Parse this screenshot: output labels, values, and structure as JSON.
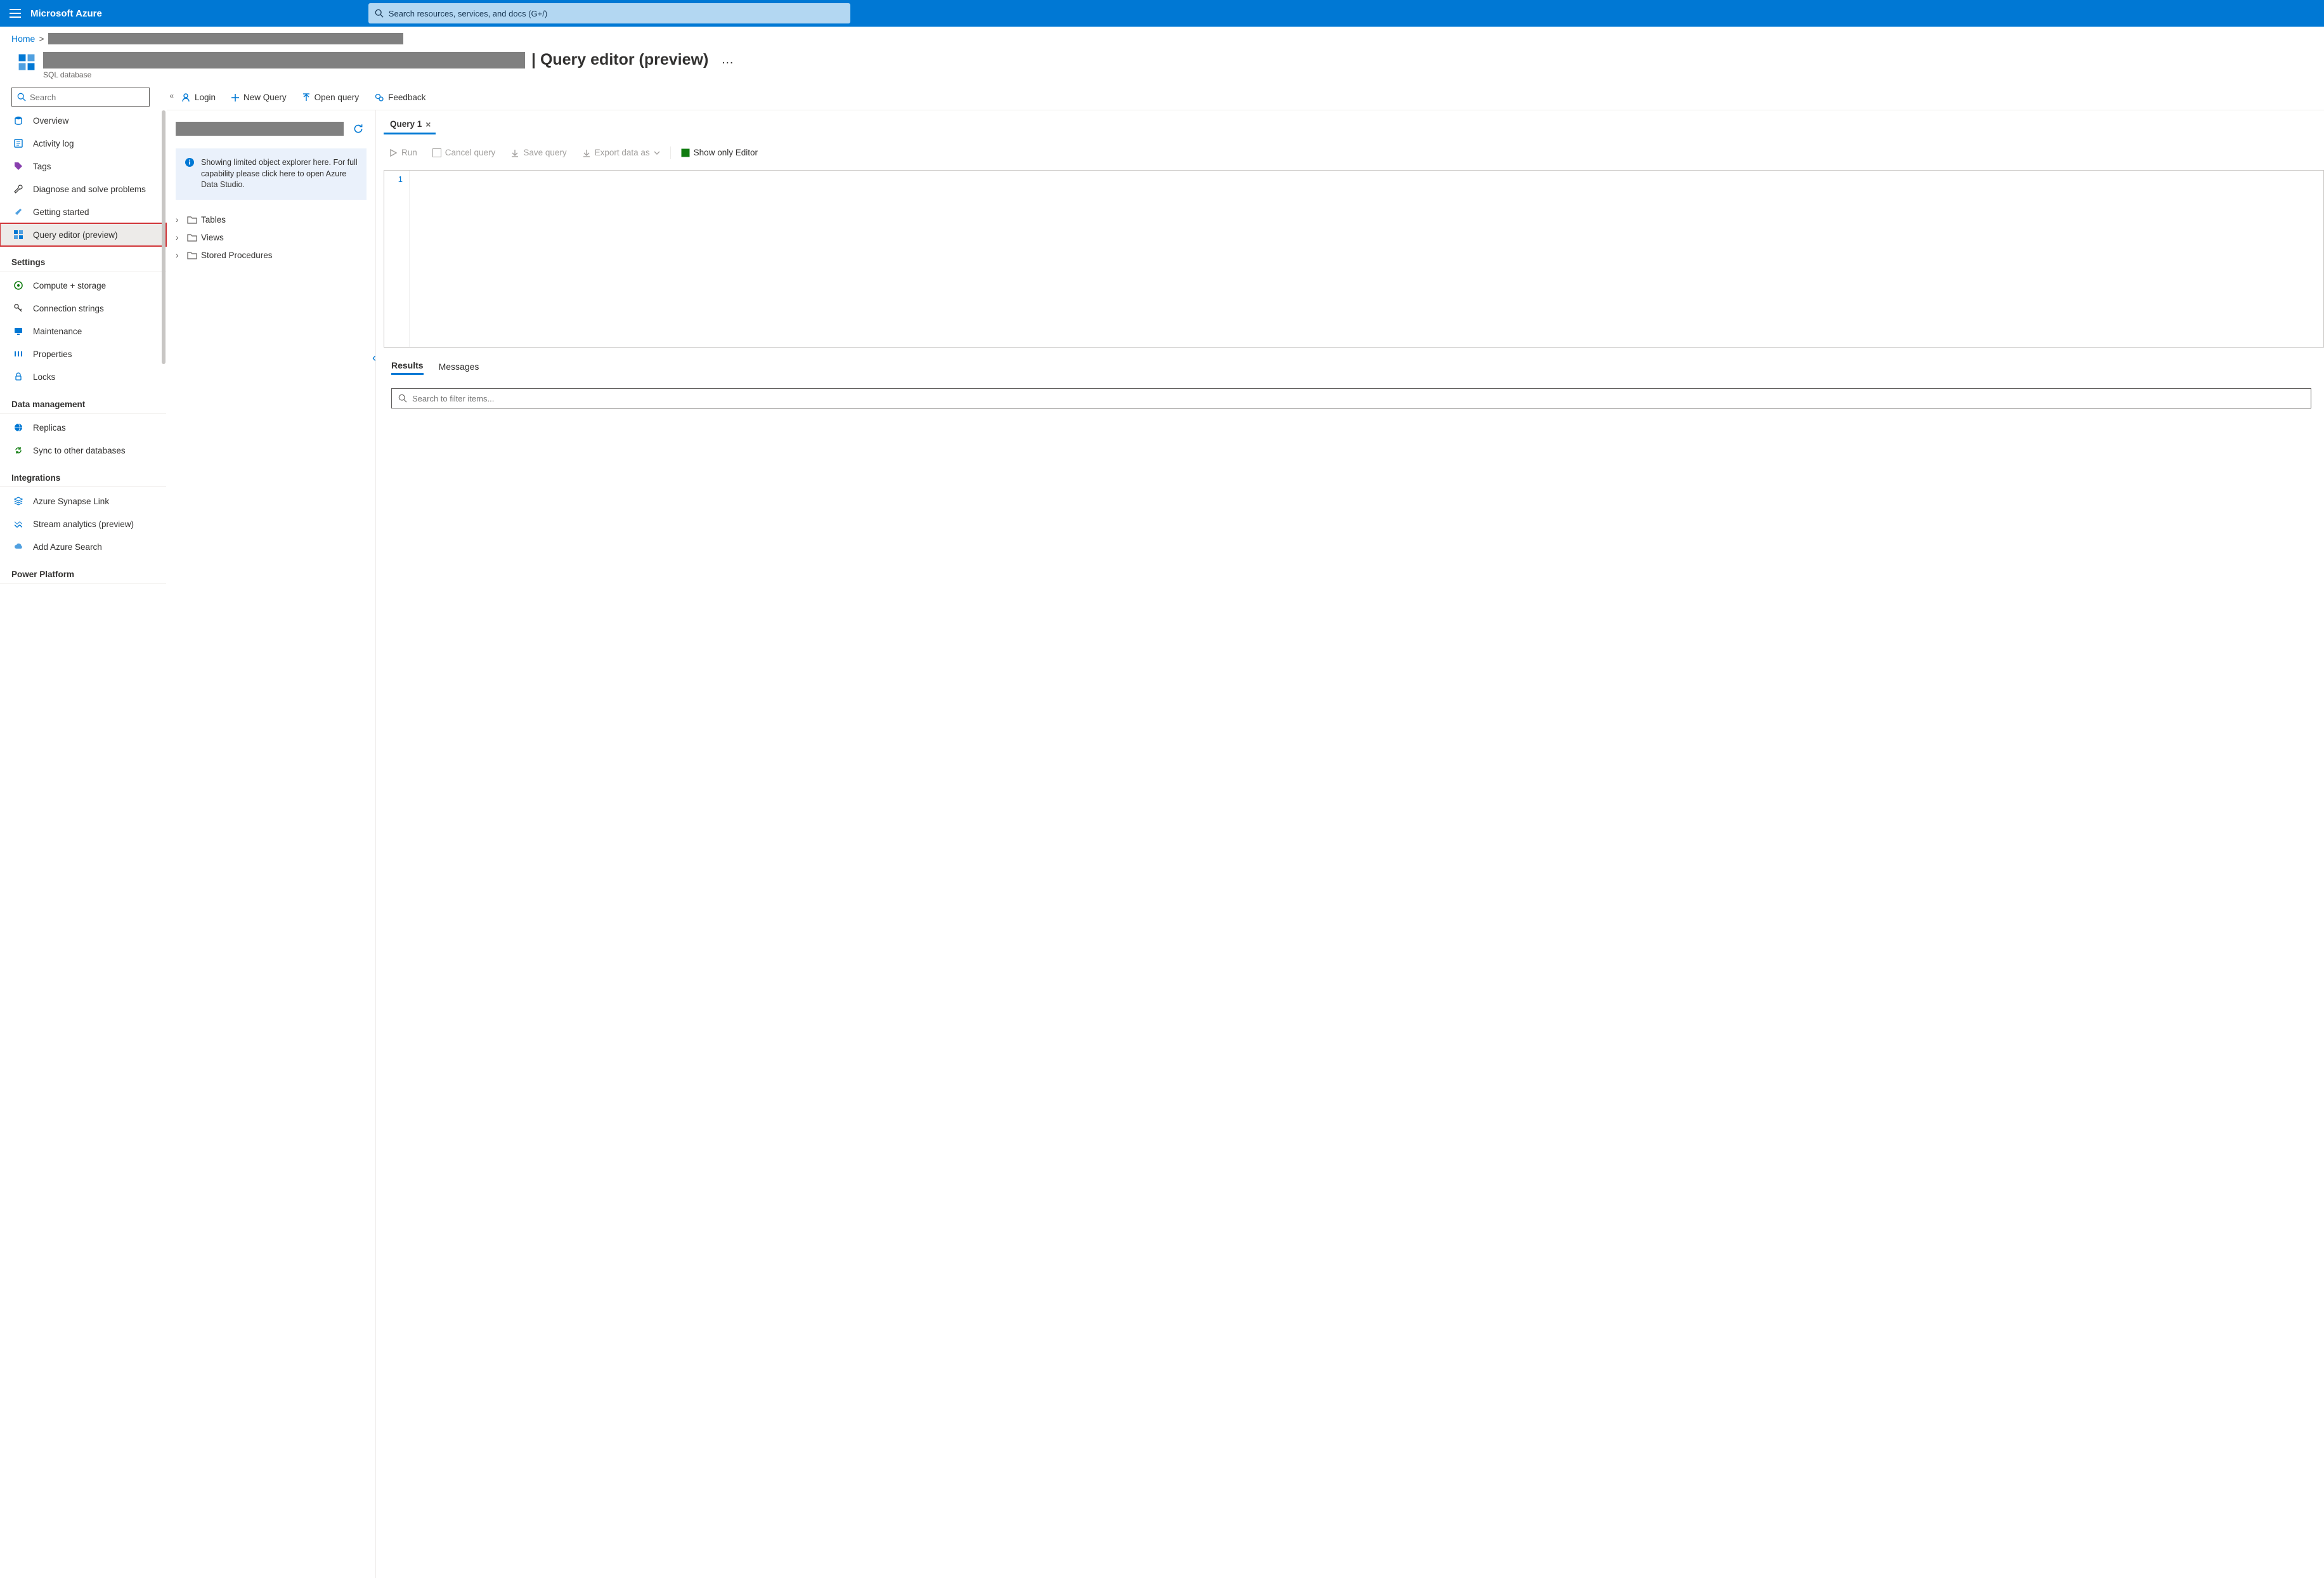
{
  "topbar": {
    "brand": "Microsoft Azure",
    "search_placeholder": "Search resources, services, and docs (G+/)"
  },
  "breadcrumb": {
    "home": "Home"
  },
  "title": {
    "tail": "| Query editor (preview)",
    "subtitle": "SQL database",
    "more": "…"
  },
  "sidebar": {
    "search_placeholder": "Search",
    "overview": "Overview",
    "activity_log": "Activity log",
    "tags": "Tags",
    "diagnose": "Diagnose and solve problems",
    "getting_started": "Getting started",
    "query_editor": "Query editor (preview)",
    "group_settings": "Settings",
    "compute": "Compute + storage",
    "conn": "Connection strings",
    "maintenance": "Maintenance",
    "properties": "Properties",
    "locks": "Locks",
    "group_data": "Data management",
    "replicas": "Replicas",
    "sync": "Sync to other databases",
    "group_integrations": "Integrations",
    "synapse": "Azure Synapse Link",
    "stream": "Stream analytics (preview)",
    "search": "Add Azure Search",
    "group_power": "Power Platform"
  },
  "cmdbar": {
    "login": "Login",
    "new_query": "New Query",
    "open_query": "Open query",
    "feedback": "Feedback"
  },
  "oe": {
    "info_message": "Showing limited object explorer here. For full capability please click here to open Azure Data Studio.",
    "tables": "Tables",
    "views": "Views",
    "sprocs": "Stored Procedures"
  },
  "qtabs": {
    "query1": "Query 1"
  },
  "qcmd": {
    "run": "Run",
    "cancel": "Cancel query",
    "save": "Save query",
    "export": "Export data as",
    "show_editor": "Show only Editor"
  },
  "editor": {
    "line1": "1"
  },
  "results": {
    "results": "Results",
    "messages": "Messages",
    "filter_placeholder": "Search to filter items..."
  }
}
